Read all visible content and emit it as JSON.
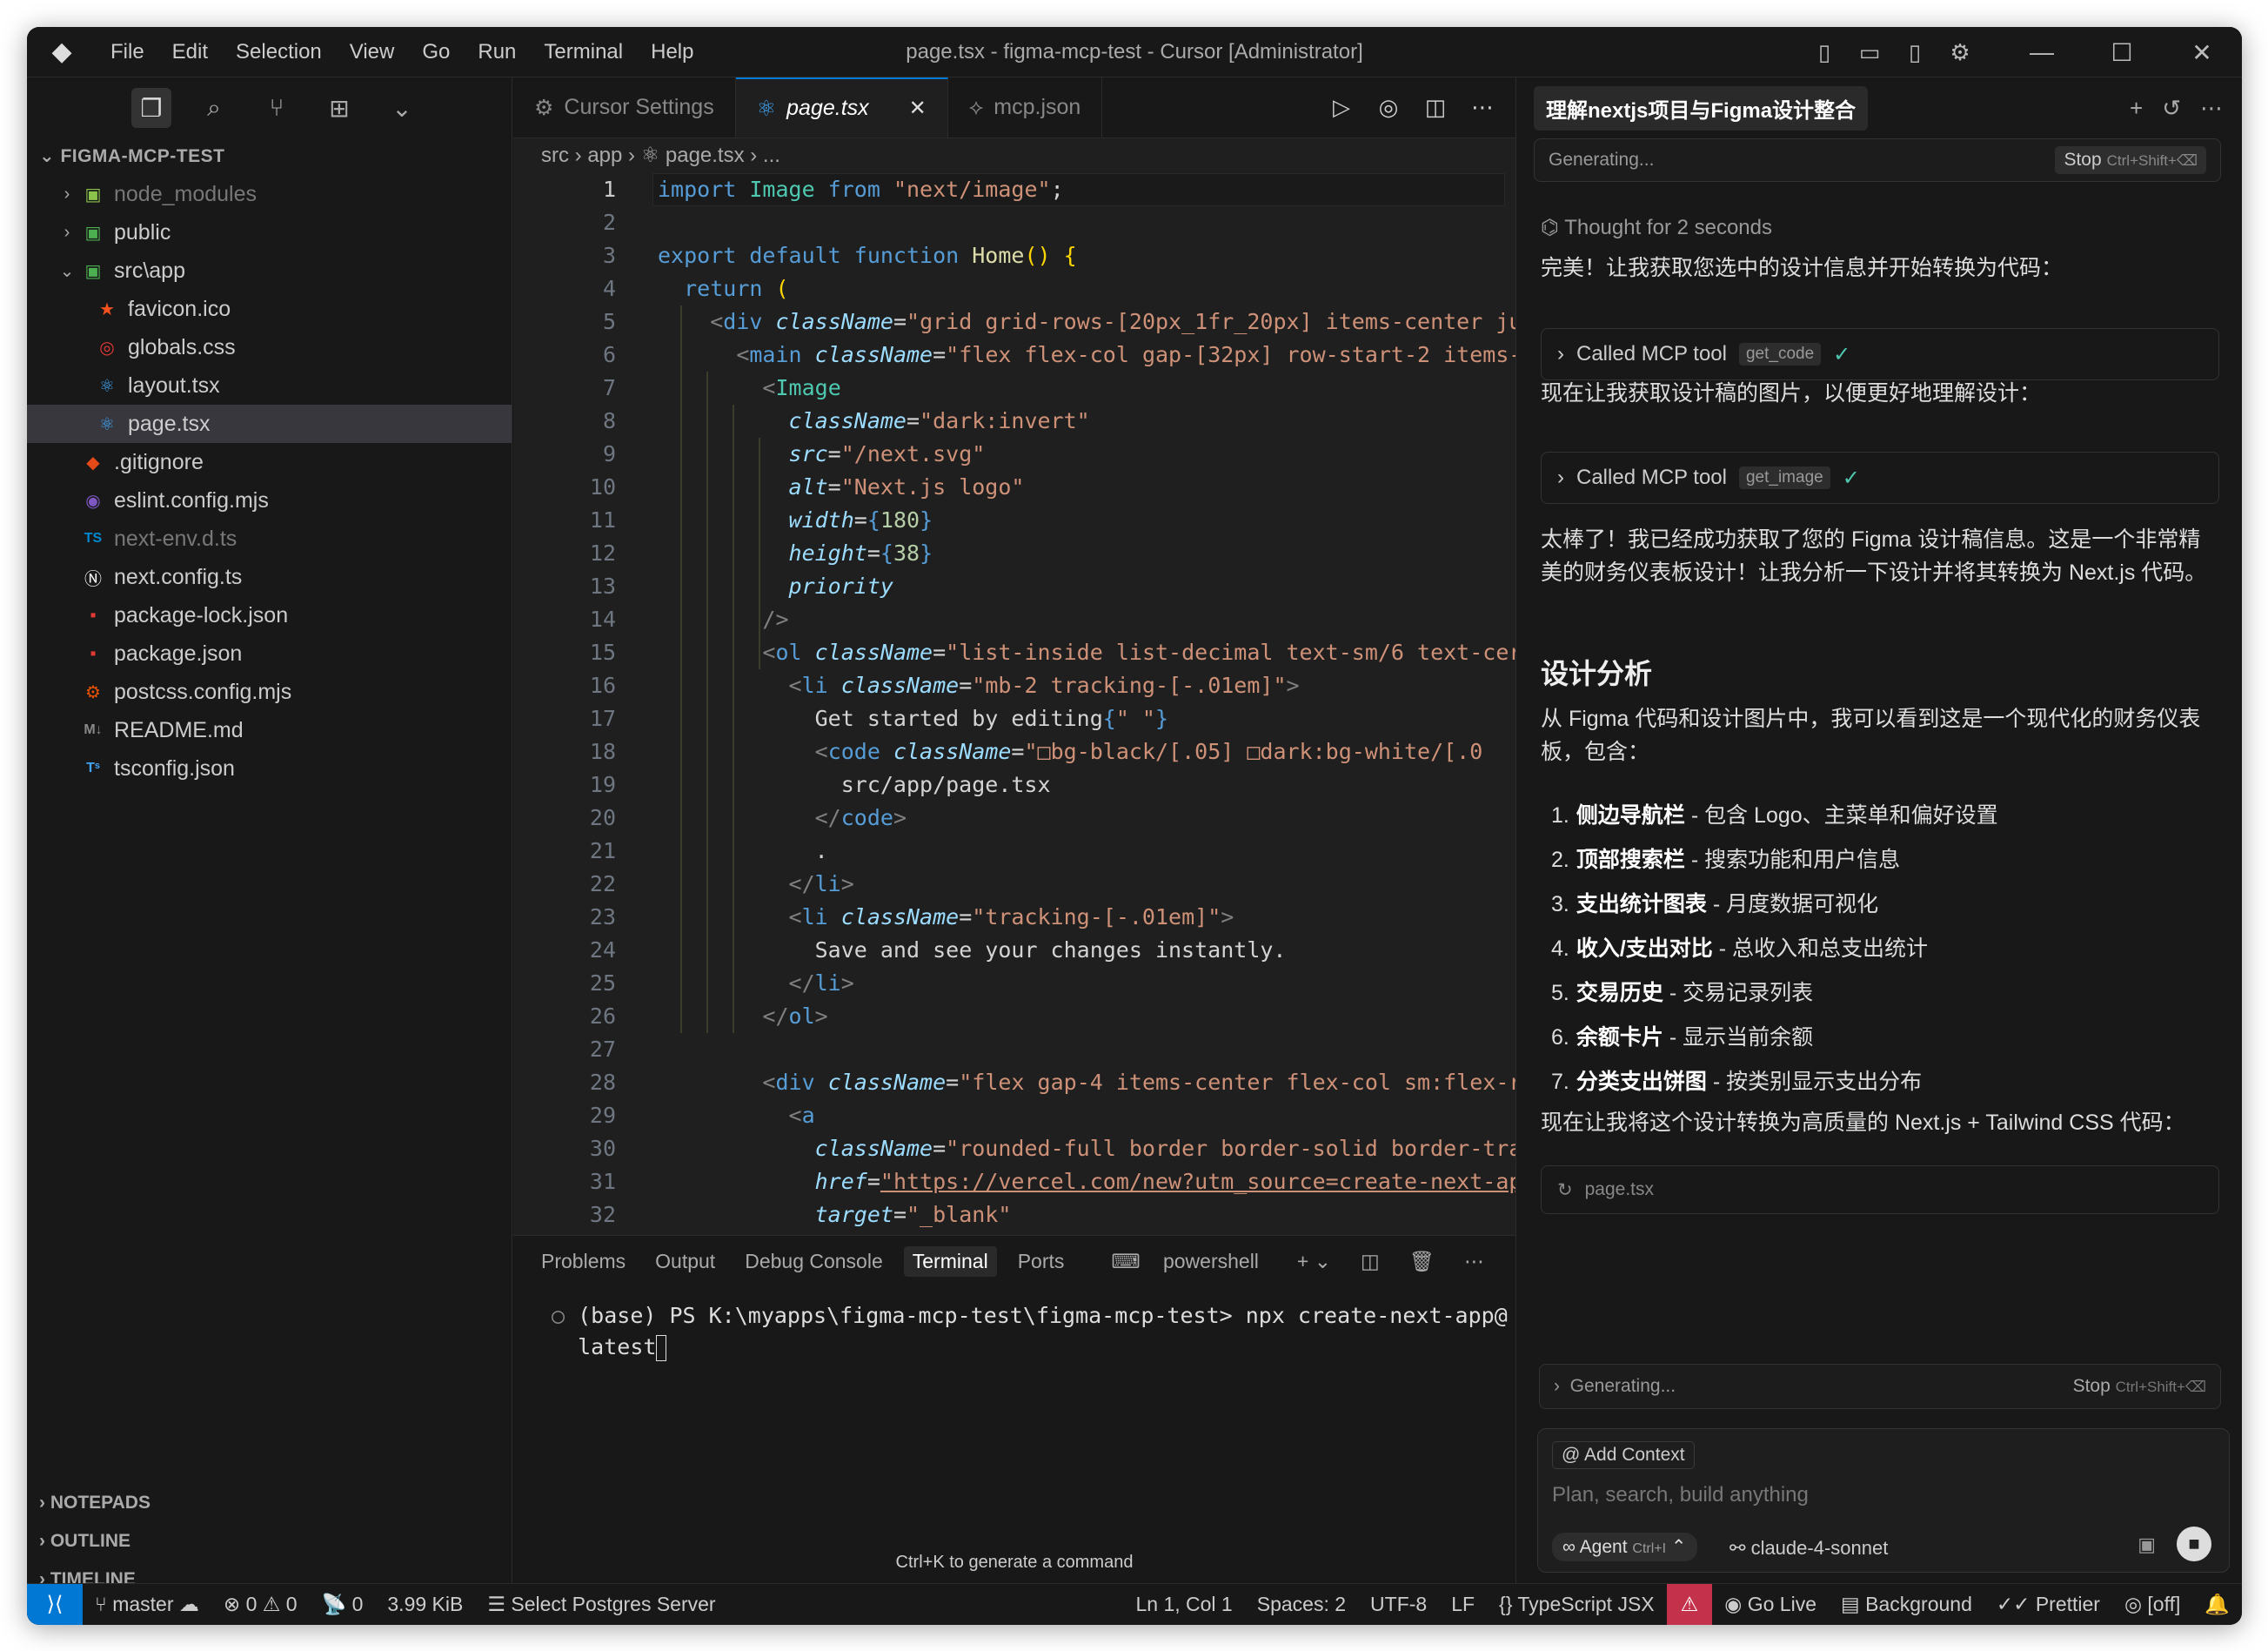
{
  "titlebar": {
    "menu": [
      "File",
      "Edit",
      "Selection",
      "View",
      "Go",
      "Run",
      "Terminal",
      "Help"
    ],
    "title": "page.tsx - figma-mcp-test - Cursor [Administrator]"
  },
  "explorer": {
    "header": "FIGMA-MCP-TEST",
    "items": [
      {
        "label": "node_modules",
        "icon": "folder-node-icon",
        "color": "#8bc34a",
        "dim": true,
        "chev": "›",
        "indent": 0
      },
      {
        "label": "public",
        "icon": "folder-public-icon",
        "color": "#4caf50",
        "dim": false,
        "chev": "›",
        "indent": 0
      },
      {
        "label": "src\\app",
        "icon": "folder-src-icon",
        "color": "#4caf50",
        "dim": false,
        "chev": "⌄",
        "indent": 0
      },
      {
        "label": "favicon.ico",
        "icon": "star-icon",
        "color": "#f4511e",
        "dim": false,
        "chev": "",
        "indent": 1
      },
      {
        "label": "globals.css",
        "icon": "css-icon",
        "color": "#e53935",
        "dim": false,
        "chev": "",
        "indent": 1
      },
      {
        "label": "layout.tsx",
        "icon": "react-icon",
        "color": "#42a5f5",
        "dim": false,
        "chev": "",
        "indent": 1
      },
      {
        "label": "page.tsx",
        "icon": "react-icon",
        "color": "#42a5f5",
        "dim": false,
        "chev": "",
        "indent": 1,
        "selected": true
      },
      {
        "label": ".gitignore",
        "icon": "git-icon",
        "color": "#e64a19",
        "dim": false,
        "chev": "",
        "indent": 0
      },
      {
        "label": "eslint.config.mjs",
        "icon": "eslint-icon",
        "color": "#7e57c2",
        "dim": false,
        "chev": "",
        "indent": 0
      },
      {
        "label": "next-env.d.ts",
        "icon": "ts-icon",
        "color": "#0288d1",
        "dim": true,
        "chev": "",
        "indent": 0
      },
      {
        "label": "next.config.ts",
        "icon": "next-icon",
        "color": "#ffffff",
        "dim": false,
        "chev": "",
        "indent": 0
      },
      {
        "label": "package-lock.json",
        "icon": "npm-icon",
        "color": "#e53935",
        "dim": false,
        "chev": "",
        "indent": 0
      },
      {
        "label": "package.json",
        "icon": "npm-icon",
        "color": "#e53935",
        "dim": false,
        "chev": "",
        "indent": 0
      },
      {
        "label": "postcss.config.mjs",
        "icon": "postcss-icon",
        "color": "#e65100",
        "dim": false,
        "chev": "",
        "indent": 0
      },
      {
        "label": "README.md",
        "icon": "markdown-icon",
        "color": "#888888",
        "dim": false,
        "chev": "",
        "indent": 0
      },
      {
        "label": "tsconfig.json",
        "icon": "tsconfig-icon",
        "color": "#42a5f5",
        "dim": false,
        "chev": "",
        "indent": 0
      }
    ],
    "footer": [
      "NOTEPADS",
      "OUTLINE",
      "TIMELINE"
    ]
  },
  "editor": {
    "tabs": [
      {
        "label": "Cursor Settings",
        "icon": "settings-icon"
      },
      {
        "label": "page.tsx",
        "icon": "react-icon",
        "active": true
      },
      {
        "label": "mcp.json",
        "icon": "json-icon"
      }
    ],
    "breadcrumb": "src  ›  app  ›  ⚛  page.tsx  ›  ...",
    "lines": [
      [
        [
          "k",
          "import "
        ],
        [
          "t",
          "Image"
        ],
        [
          "k",
          " from "
        ],
        [
          "s",
          "\"next/image\""
        ],
        [
          "",
          "; "
        ]
      ],
      [],
      [
        [
          "k",
          "export default function "
        ],
        [
          "f",
          "Home"
        ],
        [
          "y",
          "() {"
        ]
      ],
      [
        [
          "",
          "  "
        ],
        [
          "k",
          "return "
        ],
        [
          "y",
          "("
        ]
      ],
      [
        [
          "",
          "    "
        ],
        [
          "p",
          "<"
        ],
        [
          "k",
          "div "
        ],
        [
          "a",
          "className"
        ],
        [
          "",
          "="
        ],
        [
          "s",
          "\"grid grid-rows-[20px_1fr_20px] items-center ju"
        ]
      ],
      [
        [
          "",
          "      "
        ],
        [
          "p",
          "<"
        ],
        [
          "k",
          "main "
        ],
        [
          "a",
          "className"
        ],
        [
          "",
          "="
        ],
        [
          "s",
          "\"flex flex-col gap-[32px] row-start-2 items-"
        ]
      ],
      [
        [
          "",
          "        "
        ],
        [
          "p",
          "<"
        ],
        [
          "t",
          "Image"
        ]
      ],
      [
        [
          "",
          "          "
        ],
        [
          "a",
          "className"
        ],
        [
          "",
          "="
        ],
        [
          "s",
          "\"dark:invert\""
        ]
      ],
      [
        [
          "",
          "          "
        ],
        [
          "a",
          "src"
        ],
        [
          "",
          "="
        ],
        [
          "s",
          "\"/next.svg\""
        ]
      ],
      [
        [
          "",
          "          "
        ],
        [
          "a",
          "alt"
        ],
        [
          "",
          "="
        ],
        [
          "s",
          "\"Next.js logo\""
        ]
      ],
      [
        [
          "",
          "          "
        ],
        [
          "a",
          "width"
        ],
        [
          "",
          "="
        ],
        [
          "k",
          "{"
        ],
        [
          "b",
          "180"
        ],
        [
          "k",
          "}"
        ]
      ],
      [
        [
          "",
          "          "
        ],
        [
          "a",
          "height"
        ],
        [
          "",
          "="
        ],
        [
          "k",
          "{"
        ],
        [
          "b",
          "38"
        ],
        [
          "k",
          "}"
        ]
      ],
      [
        [
          "",
          "          "
        ],
        [
          "a",
          "priority"
        ]
      ],
      [
        [
          "",
          "        "
        ],
        [
          "p",
          "/>"
        ]
      ],
      [
        [
          "",
          "        "
        ],
        [
          "p",
          "<"
        ],
        [
          "k",
          "ol "
        ],
        [
          "a",
          "className"
        ],
        [
          "",
          "="
        ],
        [
          "s",
          "\"list-inside list-decimal text-sm/6 text-cer"
        ]
      ],
      [
        [
          "",
          "          "
        ],
        [
          "p",
          "<"
        ],
        [
          "k",
          "li "
        ],
        [
          "a",
          "className"
        ],
        [
          "",
          "="
        ],
        [
          "s",
          "\"mb-2 tracking-[-.01em]\""
        ],
        [
          "p",
          ">"
        ]
      ],
      [
        [
          "",
          "            "
        ],
        [
          "",
          "Get started by editing"
        ],
        [
          "k",
          "{"
        ],
        [
          "s",
          "\" \""
        ],
        [
          "k",
          "}"
        ]
      ],
      [
        [
          "",
          "            "
        ],
        [
          "p",
          "<"
        ],
        [
          "k",
          "code "
        ],
        [
          "a",
          "className"
        ],
        [
          "",
          "="
        ],
        [
          "s",
          "\"□bg-black/[.05] □dark:bg-white/[.0"
        ]
      ],
      [
        [
          "",
          "              "
        ],
        [
          "",
          "src/app/page.tsx"
        ]
      ],
      [
        [
          "",
          "            "
        ],
        [
          "p",
          "</"
        ],
        [
          "k",
          "code"
        ],
        [
          "p",
          ">"
        ]
      ],
      [
        [
          "",
          "            "
        ],
        [
          "",
          "."
        ]
      ],
      [
        [
          "",
          "          "
        ],
        [
          "p",
          "</"
        ],
        [
          "k",
          "li"
        ],
        [
          "p",
          ">"
        ]
      ],
      [
        [
          "",
          "          "
        ],
        [
          "p",
          "<"
        ],
        [
          "k",
          "li "
        ],
        [
          "a",
          "className"
        ],
        [
          "",
          "="
        ],
        [
          "s",
          "\"tracking-[-.01em]\""
        ],
        [
          "p",
          ">"
        ]
      ],
      [
        [
          "",
          "            "
        ],
        [
          "",
          "Save and see your changes instantly."
        ]
      ],
      [
        [
          "",
          "          "
        ],
        [
          "p",
          "</"
        ],
        [
          "k",
          "li"
        ],
        [
          "p",
          ">"
        ]
      ],
      [
        [
          "",
          "        "
        ],
        [
          "p",
          "</"
        ],
        [
          "k",
          "ol"
        ],
        [
          "p",
          ">"
        ]
      ],
      [],
      [
        [
          "",
          "        "
        ],
        [
          "p",
          "<"
        ],
        [
          "k",
          "div "
        ],
        [
          "a",
          "className"
        ],
        [
          "",
          "="
        ],
        [
          "s",
          "\"flex gap-4 items-center flex-col sm:flex-r"
        ]
      ],
      [
        [
          "",
          "          "
        ],
        [
          "p",
          "<"
        ],
        [
          "k",
          "a"
        ]
      ],
      [
        [
          "",
          "            "
        ],
        [
          "a",
          "className"
        ],
        [
          "",
          "="
        ],
        [
          "s",
          "\"rounded-full border border-solid border-tra"
        ]
      ],
      [
        [
          "",
          "            "
        ],
        [
          "a",
          "href"
        ],
        [
          "",
          "="
        ],
        [
          "s",
          "\"https://vercel.com/new?utm_source=create-next-ap"
        ]
      ],
      [
        [
          "",
          "            "
        ],
        [
          "a",
          "target"
        ],
        [
          "",
          "="
        ],
        [
          "s",
          "\"_blank\""
        ]
      ]
    ]
  },
  "panel": {
    "tabs": [
      "Problems",
      "Output",
      "Debug Console",
      "Terminal",
      "Ports"
    ],
    "active": "Terminal",
    "shell": "powershell",
    "terminal_line1": "(base) PS K:\\myapps\\figma-mcp-test\\figma-mcp-test> npx create-next-app@",
    "terminal_line2": "latest",
    "hint": "Ctrl+K to generate a command"
  },
  "chat": {
    "tab_title": "理解nextjs项目与Figma设计整合",
    "generating_top": "Generating...",
    "stop_label": "Stop",
    "stop_shortcut": "Ctrl+Shift+⌫",
    "thought": "Thought for 2 seconds",
    "msg1": "完美！让我获取您选中的设计信息并开始转换为代码：",
    "tool1": {
      "label": "Called MCP tool",
      "tag": "get_code"
    },
    "msg2": "现在让我获取设计稿的图片，以便更好地理解设计：",
    "tool2": {
      "label": "Called MCP tool",
      "tag": "get_image"
    },
    "msg3": "太棒了！我已经成功获取了您的 Figma 设计稿信息。这是一个非常精美的财务仪表板设计！让我分析一下设计并将其转换为 Next.js 代码。",
    "heading": "设计分析",
    "msg4": "从 Figma 代码和设计图片中，我可以看到这是一个现代化的财务仪表板，包含：",
    "list": [
      {
        "n": "1.",
        "b": "侧边导航栏",
        "t": " - 包含 Logo、主菜单和偏好设置"
      },
      {
        "n": "2.",
        "b": "顶部搜索栏",
        "t": " - 搜索功能和用户信息"
      },
      {
        "n": "3.",
        "b": "支出统计图表",
        "t": " - 月度数据可视化"
      },
      {
        "n": "4.",
        "b": "收入/支出对比",
        "t": " - 总收入和总支出统计"
      },
      {
        "n": "5.",
        "b": "交易历史",
        "t": " - 交易记录列表"
      },
      {
        "n": "6.",
        "b": "余额卡片",
        "t": " - 显示当前余额"
      },
      {
        "n": "7.",
        "b": "分类支出饼图",
        "t": " - 按类别显示支出分布"
      }
    ],
    "msg5": "现在让我将这个设计转换为高质量的 Next.js + Tailwind CSS 代码：",
    "file_chip": "page.tsx",
    "generating_bottom": "Generating...",
    "add_context": "Add Context",
    "placeholder": "Plan, search, build anything",
    "agent": "Agent",
    "agent_shortcut": "Ctrl+I",
    "model": "claude-4-sonnet"
  },
  "statusbar": {
    "branch": "master",
    "errors": "0",
    "warnings": "0",
    "ports": "0",
    "size": "3.99 KiB",
    "db": "Select Postgres Server",
    "position": "Ln 1, Col 1",
    "spaces": "Spaces: 2",
    "encoding": "UTF-8",
    "eol": "LF",
    "language": "TypeScript JSX",
    "golive": "Go Live",
    "background": "Background",
    "prettier": "Prettier",
    "off": "[off]"
  }
}
